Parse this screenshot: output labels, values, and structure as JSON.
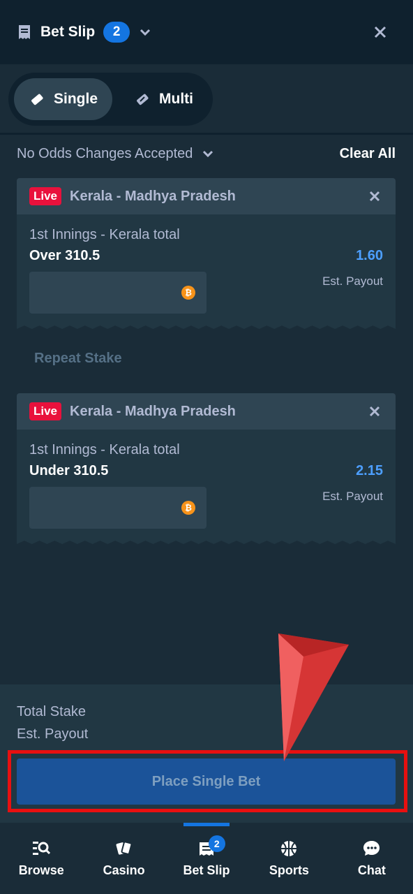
{
  "header": {
    "title": "Bet Slip",
    "count": "2"
  },
  "mode_toggle": {
    "single_label": "Single",
    "multi_label": "Multi",
    "selected": "Single"
  },
  "odds_pref": {
    "label": "No Odds Changes Accepted",
    "clear_all": "Clear All"
  },
  "bets": [
    {
      "live": "Live",
      "match": "Kerala - Madhya Pradesh",
      "market": "1st Innings - Kerala total",
      "selection": "Over 310.5",
      "odds": "1.60",
      "payout_label": "Est. Payout"
    },
    {
      "live": "Live",
      "match": "Kerala - Madhya Pradesh",
      "market": "1st Innings - Kerala total",
      "selection": "Under 310.5",
      "odds": "2.15",
      "payout_label": "Est. Payout"
    }
  ],
  "repeat_stake": "Repeat Stake",
  "summary": {
    "total_stake_label": "Total Stake",
    "est_payout_label": "Est. Payout"
  },
  "place_bet": "Place Single Bet",
  "tabs": [
    {
      "label": "Browse",
      "icon": "browse-icon"
    },
    {
      "label": "Casino",
      "icon": "cards-icon"
    },
    {
      "label": "Bet Slip",
      "icon": "betslip-icon",
      "badge": "2",
      "active": true
    },
    {
      "label": "Sports",
      "icon": "basketball-icon"
    },
    {
      "label": "Chat",
      "icon": "chat-icon"
    }
  ],
  "colors": {
    "accent": "#1475e1",
    "live": "#e9113c",
    "odds": "#4d9fff",
    "highlight": "#e81010"
  }
}
